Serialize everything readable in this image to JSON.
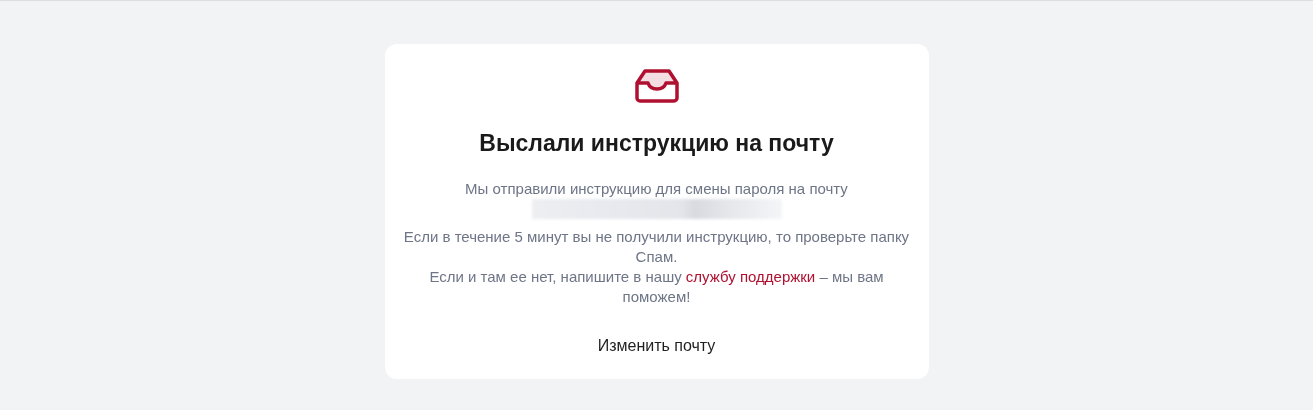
{
  "card": {
    "title": "Выслали инструкцию на почту",
    "sent_text": "Мы отправили инструкцию для смены пароля на почту",
    "email_redacted": true,
    "spam_text": "Если в течение 5 минут вы не получили инструкцию, то проверьте папку Спам.",
    "support_text": {
      "before": "Если и там ее нет, напишите в нашу",
      "link": "службу поддержки",
      "after": "– мы вам поможем!"
    },
    "change_button": "Изменить почту"
  }
}
